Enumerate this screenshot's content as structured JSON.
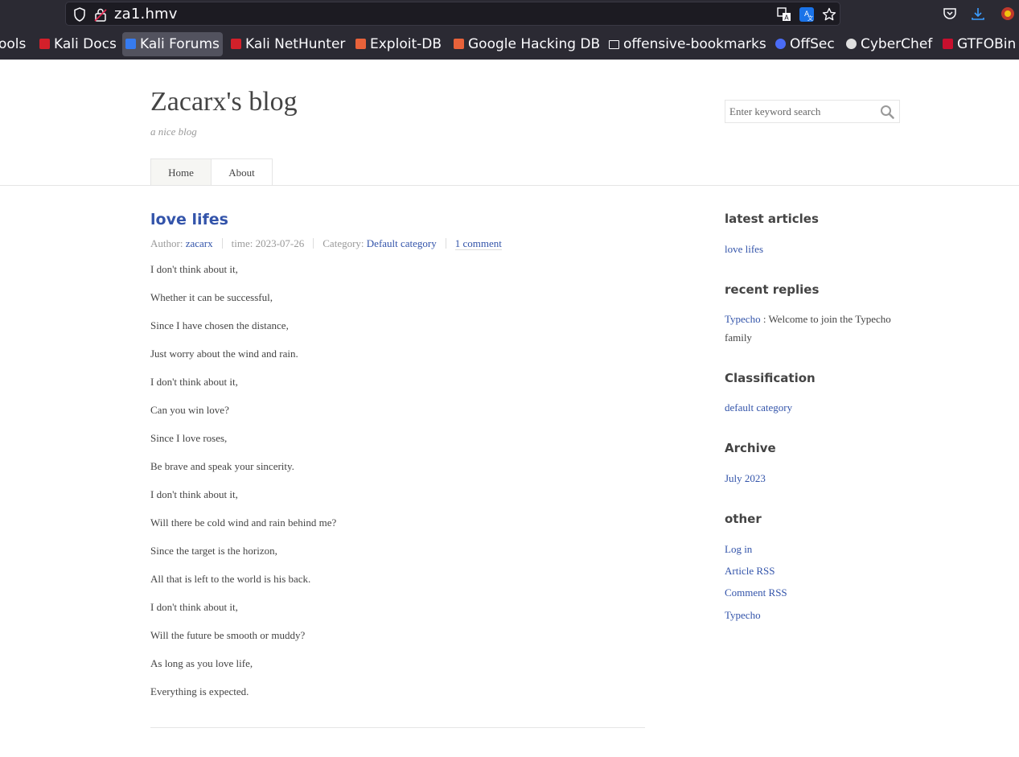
{
  "browser": {
    "url": "za1.hmv",
    "bookmarks": [
      {
        "label": "ools",
        "color": ""
      },
      {
        "label": "Kali Docs",
        "color": "#d3202a"
      },
      {
        "label": "Kali Forums",
        "color": "#367bf0",
        "active": true
      },
      {
        "label": "Kali NetHunter",
        "color": "#d3202a"
      },
      {
        "label": "Exploit-DB",
        "color": "#e8623a"
      },
      {
        "label": "Google Hacking DB",
        "color": "#e8623a"
      },
      {
        "label": "offensive-bookmarks",
        "color": ""
      },
      {
        "label": "OffSec",
        "color": "#4a6cf7"
      },
      {
        "label": "CyberChef",
        "color": "#e0e0e0"
      },
      {
        "label": "GTFOBin",
        "color": "#c8102e"
      }
    ]
  },
  "site": {
    "title": "Zacarx's blog",
    "description": "a nice blog",
    "search_placeholder": "Enter keyword search",
    "nav": [
      "Home",
      "About"
    ]
  },
  "post": {
    "title": "love lifes",
    "meta": {
      "author_label": "Author:",
      "author": "zacarx",
      "time": "time: 2023-07-26",
      "category_label": "Category:",
      "category": "Default category",
      "comments": "1 comment"
    },
    "lines": [
      "I don't think about it,",
      "Whether it can be successful,",
      "Since I have chosen the distance,",
      "Just worry about the wind and rain.",
      "I don't think about it,",
      "Can you win love?",
      "Since I love roses,",
      "Be brave and speak your sincerity.",
      "I don't think about it,",
      "Will there be cold wind and rain behind me?",
      "Since the target is the horizon,",
      "All that is left to the world is his back.",
      "I don't think about it,",
      "Will the future be smooth or muddy?",
      "As long as you love life,",
      "Everything is expected."
    ]
  },
  "sidebar": {
    "latest_title": "latest articles",
    "latest": [
      "love lifes"
    ],
    "replies_title": "recent replies",
    "reply_author": "Typecho",
    "reply_text": ": Welcome to join the Typecho family",
    "class_title": "Classification",
    "classes": [
      "default category"
    ],
    "archive_title": "Archive",
    "archives": [
      "July 2023"
    ],
    "other_title": "other",
    "other": [
      "Log in",
      "Article RSS",
      "Comment RSS",
      "Typecho"
    ]
  }
}
